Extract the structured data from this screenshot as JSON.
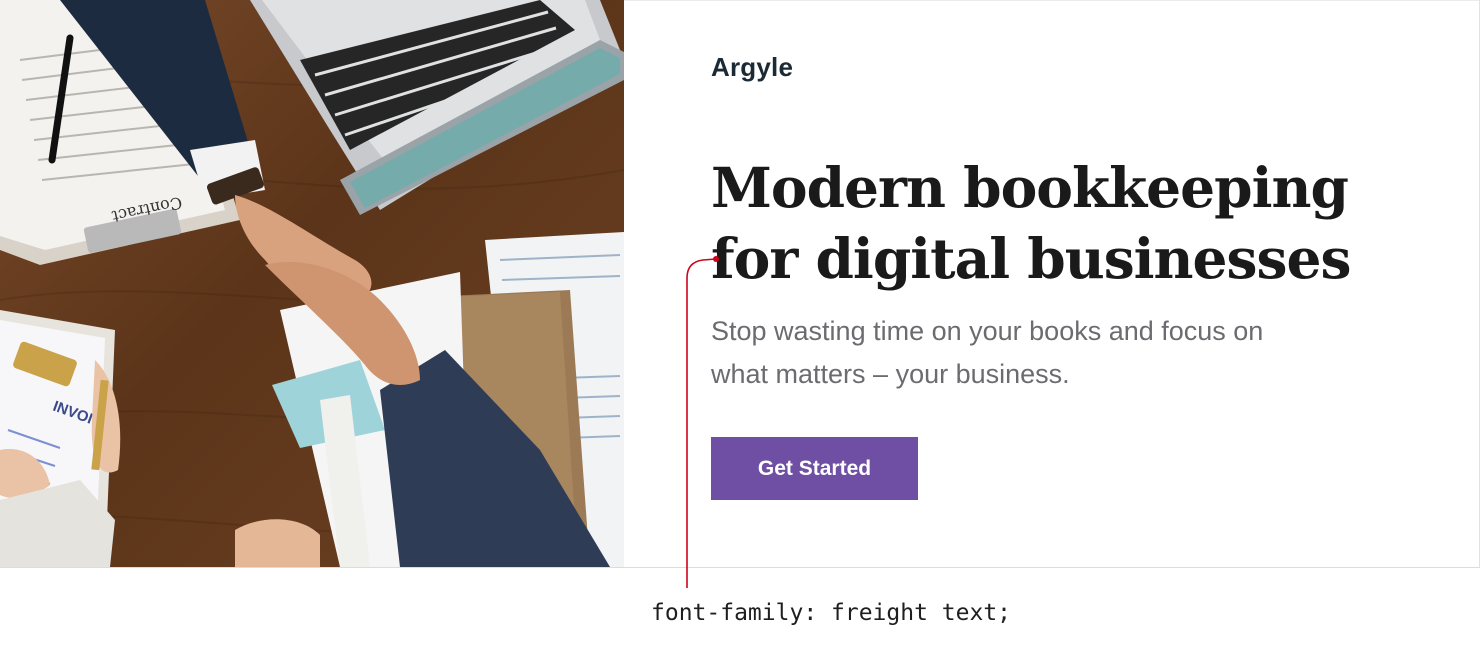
{
  "hero": {
    "brand": "Argyle",
    "headline_line1": "Modern bookkeeping",
    "headline_line2": "for digital businesses",
    "subhead_line1": "Stop wasting time on your books and focus on",
    "subhead_line2": "what matters – your business.",
    "cta_label": "Get Started",
    "cta_color": "#6e4fa3",
    "image_label_contract": "Contract",
    "image_label_invoice": "INVOICE",
    "image_icon": "business-handshake-photo"
  },
  "annotation": {
    "text": "font-family: freight text;",
    "color": "#d0021b"
  }
}
